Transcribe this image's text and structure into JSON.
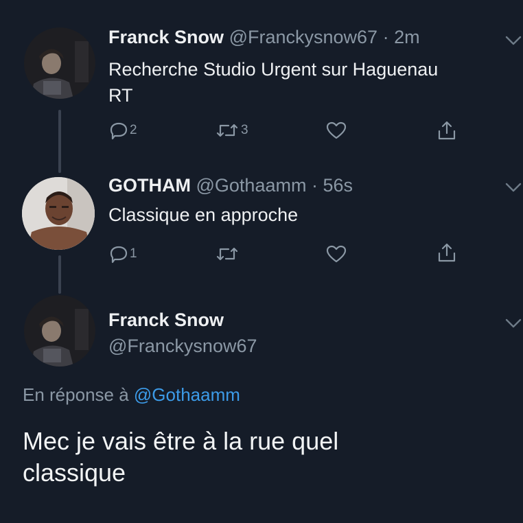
{
  "tweets": [
    {
      "name": "Franck Snow",
      "handle": "@Franckysnow67",
      "time": "· 2m",
      "text_lines": [
        "Recherche Studio Urgent sur Haguenau",
        "RT"
      ],
      "actions": {
        "replies": "2",
        "retweets": "3",
        "likes": "",
        "share": ""
      }
    },
    {
      "name": "GOTHAM",
      "handle": "@Gothaamm",
      "time": "· 56s",
      "text_lines": [
        "Classique en approche"
      ],
      "actions": {
        "replies": "1",
        "retweets": "",
        "likes": "",
        "share": ""
      }
    }
  ],
  "focused_tweet": {
    "name": "Franck Snow",
    "handle": "@Franckysnow67",
    "reply_prefix": "En réponse à ",
    "reply_mention": "@Gothaamm",
    "text_lines": [
      "Mec je vais être à la rue quel",
      "classique"
    ]
  },
  "icons": {
    "reply": "reply-bubble-icon",
    "retweet": "retweet-icon",
    "like": "heart-icon",
    "share": "share-icon",
    "more": "chevron-down-icon"
  },
  "colors": {
    "background": "#151c28",
    "text": "#eef0f2",
    "secondary": "#8b98a5",
    "link": "#3c9be8",
    "thread_line": "#3a4250"
  }
}
